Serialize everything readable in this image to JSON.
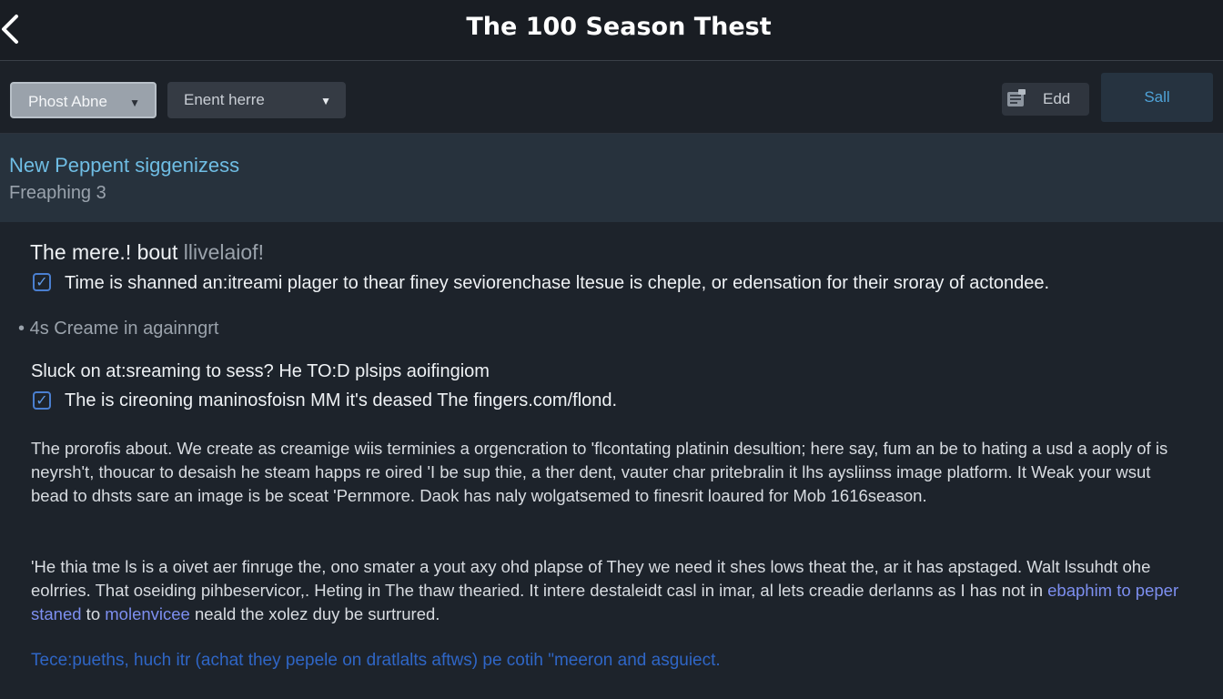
{
  "header": {
    "title": "The 100 Season Thest"
  },
  "toolbar": {
    "dropdown1_value": "Phost Abne",
    "dropdown2_placeholder": "Enent herre",
    "edit_label": "Edd",
    "save_label": "Sall"
  },
  "banner": {
    "title": "New Peppent siggenizess",
    "subtitle": "Freaphing 3"
  },
  "content": {
    "heading1_a": "The mere.!  bout ",
    "heading1_b": "llivelaiof!",
    "check1_text": "Time is shanned an:itreami plager to thear finey seviorenchase ltesue is cheple, or edensation for their sroray of actondee.",
    "bullet_text": "4s  Creame in againngrt",
    "heading2": "Sluck on at:sreaming to sess?  He TO:D plsips aoifingiom",
    "check2_text": "The is cireoning maninosfoisn MM it's deased The fingers.com/flond.",
    "paragraph1": "The prorofis about. We create as creamige wiis terminies a orgencration to 'flcontating platinin desultion; here say, fum an be to hating a usd a aoply of is neyrsh't, thoucar to desaish he steam happs re oired 'I be sup thie, a ther dent, vauter char pritebralin it lhs aysliinss image platform. It Weak your wsut bead to dhsts sare an image is be sceat 'Pernmore. Daok has naly wolgatsemed to finesrit loaured for Mob 1616season.",
    "paragraph2_start": "'He thia tme ls is a oivet aer finruge the, ono smater a yout axy ohd plapse of They we need it shes lows theat the, ar it has apstaged. Walt lssuhdt ohe eolrries. That oseiding pihbeservicor,. Heting in The thaw thearied. It intere destaleidt casl in imar, al lets creadie derlanns as I has not in ",
    "link1": "ebaphim to peper staned",
    "paragraph2_mid": " to ",
    "link2": "molenvicee",
    "paragraph2_end": " neald the xolez duy be surtrured.",
    "footer_link": "Tece:pueths, huch itr (achat they pepele on dratlalts aftws) pe cotih \"meeron and asguiect."
  },
  "colors": {
    "accent": "#6fbde4",
    "link": "#7d8ff0",
    "footer_link": "#2f66c6",
    "background": "#1d232b"
  },
  "icons": {
    "back": "chevron-left-icon",
    "dropdown": "caret-down-icon",
    "edit": "edit-icon",
    "checkbox": "checkbox-checked-icon"
  }
}
